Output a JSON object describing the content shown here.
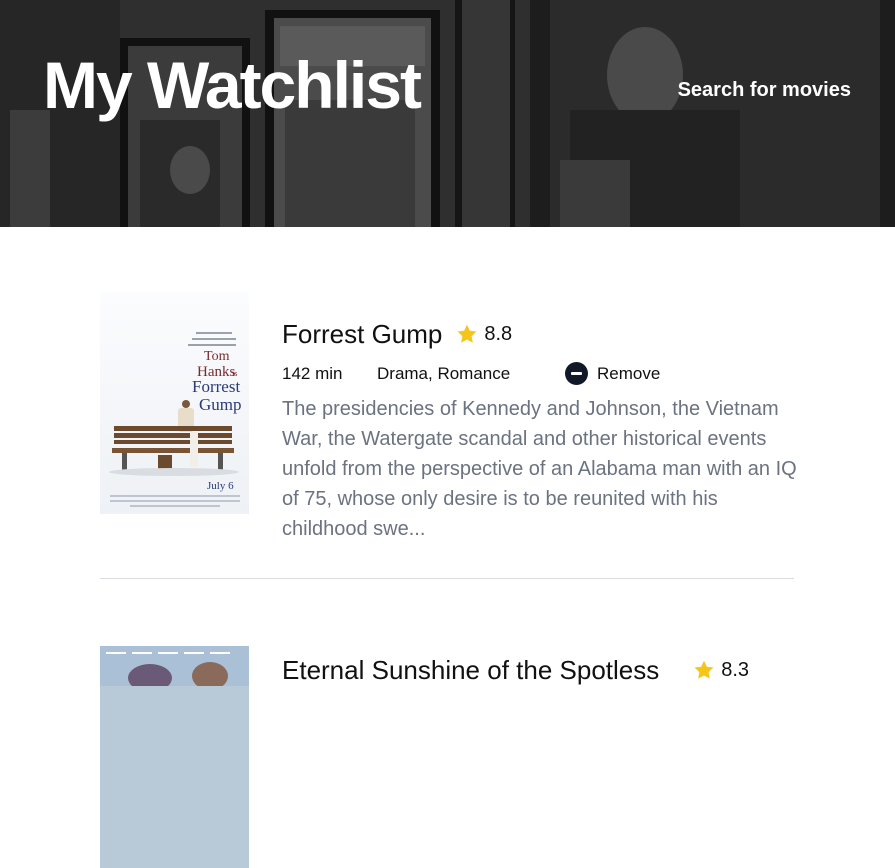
{
  "header": {
    "title": "My Watchlist",
    "search_link": "Search for movies"
  },
  "films": [
    {
      "title": "Forrest Gump",
      "rating": "8.8",
      "runtime": "142 min",
      "genre": "Drama, Romance",
      "remove_label": "Remove",
      "overview": "The presidencies of Kennedy and Johnson, the Vietnam War, the Watergate scandal and other historical events unfold from the perspective of an Alabama man with an IQ of 75, whose only desire is to be reunited with his childhood swe...",
      "poster": {
        "lines": [
          "Tom",
          "Hanks",
          "is",
          "Forrest",
          "Gump"
        ],
        "date": "July 6"
      }
    },
    {
      "title": "Eternal Sunshine of the Spotless",
      "rating": "8.3"
    }
  ],
  "colors": {
    "accent_star": "#F5C518",
    "remove_icon": "#111827",
    "overview_text": "#6B7280",
    "header_text": "#FFFFFF"
  },
  "icons": [
    "star-icon",
    "remove-icon"
  ]
}
